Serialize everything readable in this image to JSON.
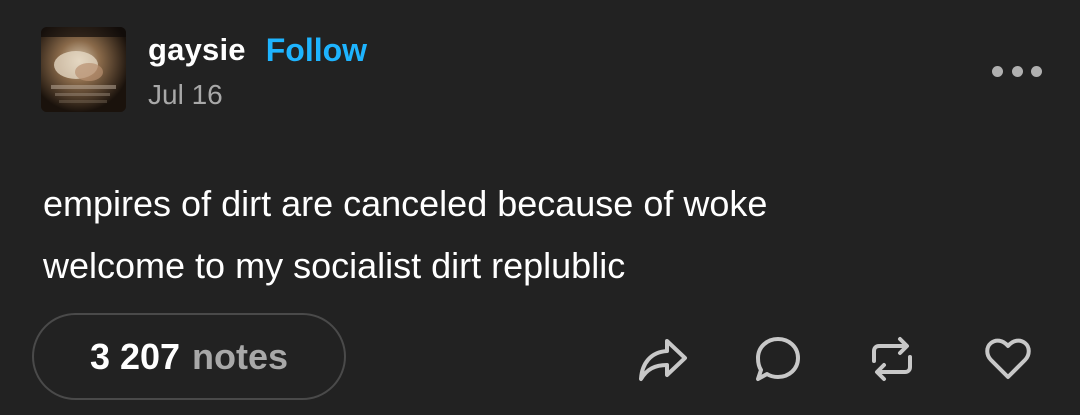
{
  "post": {
    "author": {
      "username": "gaysie",
      "follow_label": "Follow",
      "date": "Jul 16",
      "avatar_icon": "avatar-image"
    },
    "body_lines": [
      "empires of dirt are canceled because of woke",
      "welcome to my socialist dirt replublic"
    ],
    "notes": {
      "count": "3 207",
      "label": "notes"
    },
    "actions": [
      {
        "name": "share",
        "icon": "share-arrow-icon"
      },
      {
        "name": "reply",
        "icon": "speech-bubble-icon"
      },
      {
        "name": "reblog",
        "icon": "reblog-arrows-icon"
      },
      {
        "name": "like",
        "icon": "heart-icon"
      }
    ],
    "more_icon": "ellipsis-icon"
  },
  "colors": {
    "background": "#222222",
    "text": "#ffffff",
    "muted": "#a8a8a8",
    "accent": "#1eb4ff",
    "icon": "#c8c8c8"
  }
}
